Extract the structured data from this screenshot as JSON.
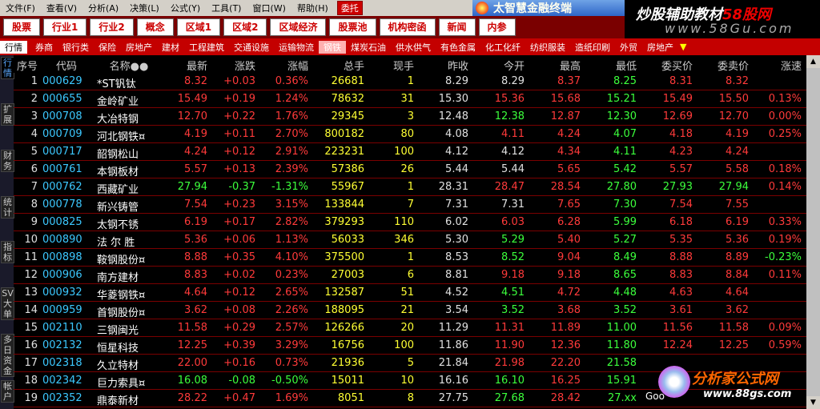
{
  "menubar": {
    "items": [
      "文件(F)",
      "查看(V)",
      "分析(A)",
      "决策(L)",
      "公式(Y)",
      "工具(T)",
      "窗口(W)",
      "帮助(H)"
    ],
    "trade_label": "委托"
  },
  "brand": {
    "title": "太智慧金融终端"
  },
  "toolbar": {
    "buttons": [
      "股票",
      "行业1",
      "行业2",
      "概念",
      "区域1",
      "区域2",
      "区域经济",
      "股票池",
      "机构密函",
      "新闻",
      "内参"
    ]
  },
  "watermark_top": {
    "line1_pre": "炒股辅助教材",
    "line1_red": "58股网",
    "line2": "www.58Gu.com"
  },
  "industrybar": {
    "first": "行情",
    "items": [
      "券商",
      "银行类",
      "保险",
      "房地产",
      "建材",
      "工程建筑",
      "交通设施",
      "运输物流",
      "钢铁",
      "煤炭石油",
      "供水供气",
      "有色金属",
      "化工化纤",
      "纺织服装",
      "造纸印刷",
      "外贸",
      "房地产"
    ],
    "active_index": 8
  },
  "sidetabs": [
    "行情",
    "扩展",
    "财务",
    "统计",
    "指标",
    "SV大单",
    "多日资金",
    "帐户"
  ],
  "columns": [
    "序号",
    "代码",
    "名称●●",
    "最新",
    "涨跌",
    "涨幅",
    "总手",
    "现手",
    "昨收",
    "今开",
    "最高",
    "最低",
    "委买价",
    "委卖价",
    "涨速"
  ],
  "rows": [
    {
      "n": "1",
      "code": "000629",
      "name": "*ST钒钛",
      "last": "8.32",
      "chg": "+0.03",
      "pct": "0.36%",
      "vol": "26681",
      "cur": "1",
      "prev": "8.29",
      "open": "8.29",
      "high": "8.37",
      "low": "8.25",
      "bid": "8.31",
      "ask": "8.32",
      "spd": ""
    },
    {
      "n": "2",
      "code": "000655",
      "name": "金岭矿业",
      "last": "15.49",
      "chg": "+0.19",
      "pct": "1.24%",
      "vol": "78632",
      "cur": "31",
      "prev": "15.30",
      "open": "15.36",
      "high": "15.68",
      "low": "15.21",
      "bid": "15.49",
      "ask": "15.50",
      "spd": "0.13%"
    },
    {
      "n": "3",
      "code": "000708",
      "name": "大冶特钢",
      "last": "12.70",
      "chg": "+0.22",
      "pct": "1.76%",
      "vol": "29345",
      "cur": "3",
      "prev": "12.48",
      "open": "12.38",
      "high": "12.87",
      "low": "12.30",
      "bid": "12.69",
      "ask": "12.70",
      "spd": "0.00%"
    },
    {
      "n": "4",
      "code": "000709",
      "name": "河北钢铁¤",
      "last": "4.19",
      "chg": "+0.11",
      "pct": "2.70%",
      "vol": "800182",
      "cur": "80",
      "prev": "4.08",
      "open": "4.11",
      "high": "4.24",
      "low": "4.07",
      "bid": "4.18",
      "ask": "4.19",
      "spd": "0.25%"
    },
    {
      "n": "5",
      "code": "000717",
      "name": "韶钢松山",
      "last": "4.24",
      "chg": "+0.12",
      "pct": "2.91%",
      "vol": "223231",
      "cur": "100",
      "prev": "4.12",
      "open": "4.12",
      "high": "4.34",
      "low": "4.11",
      "bid": "4.23",
      "ask": "4.24",
      "spd": ""
    },
    {
      "n": "6",
      "code": "000761",
      "name": "本钢板材",
      "last": "5.57",
      "chg": "+0.13",
      "pct": "2.39%",
      "vol": "57386",
      "cur": "26",
      "prev": "5.44",
      "open": "5.44",
      "high": "5.65",
      "low": "5.42",
      "bid": "5.57",
      "ask": "5.58",
      "spd": "0.18%"
    },
    {
      "n": "7",
      "code": "000762",
      "name": "西藏矿业",
      "last": "27.94",
      "chg": "-0.37",
      "pct": "-1.31%",
      "vol": "55967",
      "cur": "1",
      "prev": "28.31",
      "open": "28.47",
      "high": "28.54",
      "low": "27.80",
      "bid": "27.93",
      "ask": "27.94",
      "spd": "0.14%"
    },
    {
      "n": "8",
      "code": "000778",
      "name": "新兴铸管",
      "last": "7.54",
      "chg": "+0.23",
      "pct": "3.15%",
      "vol": "133844",
      "cur": "7",
      "prev": "7.31",
      "open": "7.31",
      "high": "7.65",
      "low": "7.30",
      "bid": "7.54",
      "ask": "7.55",
      "spd": ""
    },
    {
      "n": "9",
      "code": "000825",
      "name": "太钢不锈",
      "last": "6.19",
      "chg": "+0.17",
      "pct": "2.82%",
      "vol": "379293",
      "cur": "110",
      "prev": "6.02",
      "open": "6.03",
      "high": "6.28",
      "low": "5.99",
      "bid": "6.18",
      "ask": "6.19",
      "spd": "0.33%"
    },
    {
      "n": "10",
      "code": "000890",
      "name": "法 尔 胜",
      "last": "5.36",
      "chg": "+0.06",
      "pct": "1.13%",
      "vol": "56033",
      "cur": "346",
      "prev": "5.30",
      "open": "5.29",
      "high": "5.40",
      "low": "5.27",
      "bid": "5.35",
      "ask": "5.36",
      "spd": "0.19%"
    },
    {
      "n": "11",
      "code": "000898",
      "name": "鞍钢股份¤",
      "last": "8.88",
      "chg": "+0.35",
      "pct": "4.10%",
      "vol": "375500",
      "cur": "1",
      "prev": "8.53",
      "open": "8.52",
      "high": "9.04",
      "low": "8.49",
      "bid": "8.88",
      "ask": "8.89",
      "spd": "-0.23%"
    },
    {
      "n": "12",
      "code": "000906",
      "name": "南方建材",
      "last": "8.83",
      "chg": "+0.02",
      "pct": "0.23%",
      "vol": "27003",
      "cur": "6",
      "prev": "8.81",
      "open": "9.18",
      "high": "9.18",
      "low": "8.65",
      "bid": "8.83",
      "ask": "8.84",
      "spd": "0.11%"
    },
    {
      "n": "13",
      "code": "000932",
      "name": "华菱钢铁¤",
      "last": "4.64",
      "chg": "+0.12",
      "pct": "2.65%",
      "vol": "132587",
      "cur": "51",
      "prev": "4.52",
      "open": "4.51",
      "high": "4.72",
      "low": "4.48",
      "bid": "4.63",
      "ask": "4.64",
      "spd": ""
    },
    {
      "n": "14",
      "code": "000959",
      "name": "首钢股份¤",
      "last": "3.62",
      "chg": "+0.08",
      "pct": "2.26%",
      "vol": "188095",
      "cur": "21",
      "prev": "3.54",
      "open": "3.52",
      "high": "3.68",
      "low": "3.52",
      "bid": "3.61",
      "ask": "3.62",
      "spd": ""
    },
    {
      "n": "15",
      "code": "002110",
      "name": "三钢闽光",
      "last": "11.58",
      "chg": "+0.29",
      "pct": "2.57%",
      "vol": "126266",
      "cur": "20",
      "prev": "11.29",
      "open": "11.31",
      "high": "11.89",
      "low": "11.00",
      "bid": "11.56",
      "ask": "11.58",
      "spd": "0.09%"
    },
    {
      "n": "16",
      "code": "002132",
      "name": "恒星科技",
      "last": "12.25",
      "chg": "+0.39",
      "pct": "3.29%",
      "vol": "16756",
      "cur": "100",
      "prev": "11.86",
      "open": "11.90",
      "high": "12.36",
      "low": "11.80",
      "bid": "12.24",
      "ask": "12.25",
      "spd": "0.59%"
    },
    {
      "n": "17",
      "code": "002318",
      "name": "久立特材",
      "last": "22.00",
      "chg": "+0.16",
      "pct": "0.73%",
      "vol": "21936",
      "cur": "5",
      "prev": "21.84",
      "open": "21.98",
      "high": "22.20",
      "low": "21.58",
      "bid": "",
      "ask": "",
      "spd": ""
    },
    {
      "n": "18",
      "code": "002342",
      "name": "巨力索具¤",
      "last": "16.08",
      "chg": "-0.08",
      "pct": "-0.50%",
      "vol": "15011",
      "cur": "10",
      "prev": "16.16",
      "open": "16.10",
      "high": "16.25",
      "low": "15.91",
      "bid": "",
      "ask": "",
      "spd": ""
    },
    {
      "n": "19",
      "code": "002352",
      "name": "鼎泰新材",
      "last": "28.22",
      "chg": "+0.47",
      "pct": "1.69%",
      "vol": "8051",
      "cur": "8",
      "prev": "27.75",
      "open": "27.68",
      "high": "28.42",
      "low": "27.xx",
      "bid": "",
      "ask": "",
      "spd": ""
    }
  ],
  "watermark_bottom": {
    "title": "分析家公式网",
    "url": "www.88gs.com"
  },
  "google_fragment": "Goo",
  "colors": {
    "up": "#ff3a3a",
    "down": "#3cff3c",
    "flat": "#e0e0e0",
    "code": "#3cc8ff",
    "name": "#ffffff",
    "vol": "#ffff33",
    "cur": "#ffff33"
  }
}
